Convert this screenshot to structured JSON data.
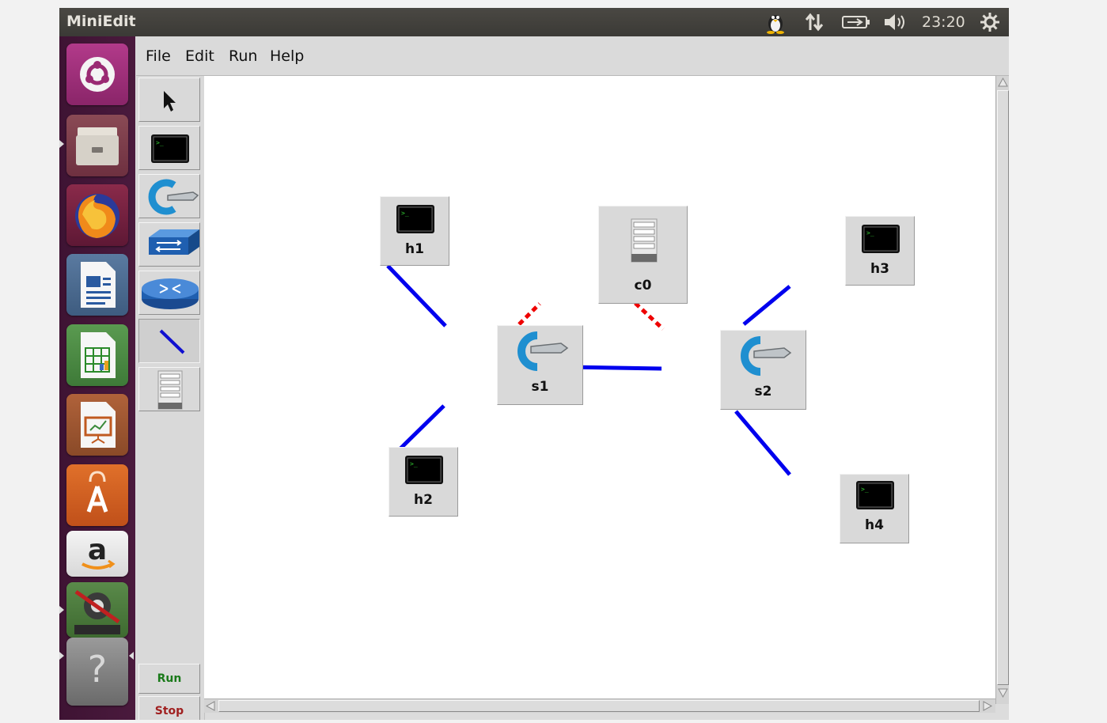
{
  "window": {
    "title": "MiniEdit"
  },
  "panel": {
    "clock": "23:20"
  },
  "menu": {
    "file": "File",
    "edit": "Edit",
    "run": "Run",
    "help": "Help"
  },
  "toolbar": {
    "run_label": "Run",
    "stop_label": "Stop"
  },
  "nodes": {
    "h1": "h1",
    "h2": "h2",
    "h3": "h3",
    "h4": "h4",
    "s1": "s1",
    "s2": "s2",
    "c0": "c0"
  },
  "colors": {
    "data_link": "#0000ee",
    "controller_link": "#ee0000",
    "run_text": "#1a7a1a",
    "stop_text": "#a02020",
    "launcher_bg": "#4a1a3d",
    "panel_bg": "#3e3d39"
  },
  "launcher_icons": [
    "ubuntu-dash-icon",
    "files-icon",
    "firefox-icon",
    "writer-icon",
    "calc-icon",
    "impress-icon",
    "software-center-icon",
    "amazon-icon",
    "settings-icon",
    "help-icon"
  ]
}
